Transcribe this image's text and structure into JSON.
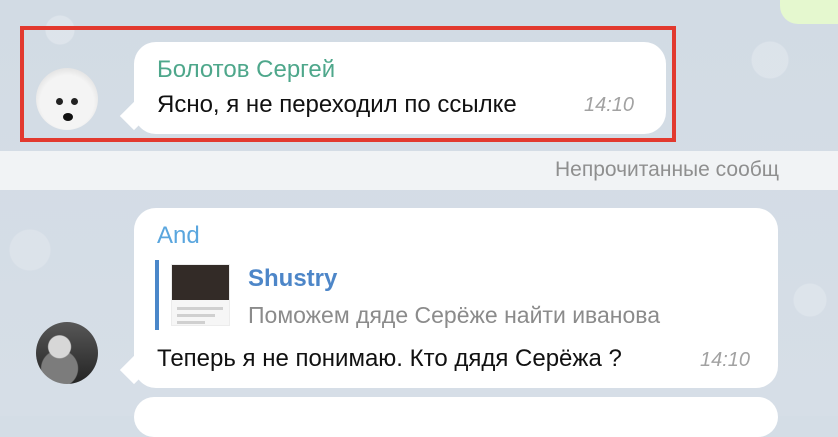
{
  "colors": {
    "highlight": "#e2392e",
    "sender_green": "#4ea78b",
    "sender_blue": "#5aa6de",
    "reply_name": "#4d86c8",
    "chat_bg": "#d4dde6",
    "divider_bg": "#f1f3f5"
  },
  "messages": [
    {
      "sender": "Болотов Сергей",
      "text": "Ясно, я не переходил по ссылке",
      "time": "14:10",
      "avatar": "arctic-fox-avatar"
    },
    {
      "sender": "And",
      "text": "Теперь я не понимаю. Кто дядя Серёжа ?",
      "time": "14:10",
      "avatar": "person-avatar",
      "reply": {
        "name": "Shustry",
        "text": "Поможем дяде Серёже найти иванова"
      }
    }
  ],
  "unread_divider": "Непрочитанные сообщ"
}
